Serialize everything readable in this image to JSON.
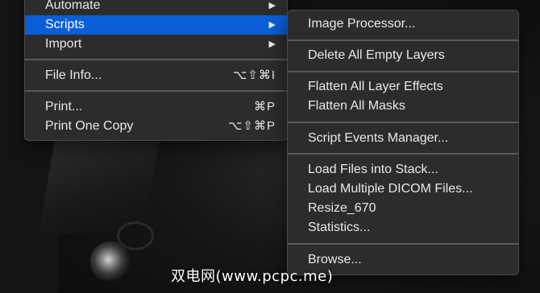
{
  "file_menu": {
    "items": [
      {
        "label": "Automate",
        "arrow": "▶"
      },
      {
        "label": "Scripts",
        "arrow": "▶"
      },
      {
        "label": "Import",
        "arrow": "▶"
      },
      {
        "label": "File Info...",
        "shortcut": "⌥⇧⌘I"
      },
      {
        "label": "Print...",
        "shortcut": "⌘P"
      },
      {
        "label": "Print One Copy",
        "shortcut": "⌥⇧⌘P"
      }
    ]
  },
  "scripts_menu": {
    "items": [
      {
        "label": "Image Processor..."
      },
      {
        "label": "Delete All Empty Layers"
      },
      {
        "label": "Flatten All Layer Effects"
      },
      {
        "label": "Flatten All Masks"
      },
      {
        "label": "Script Events Manager..."
      },
      {
        "label": "Load Files into Stack..."
      },
      {
        "label": "Load Multiple DICOM Files..."
      },
      {
        "label": "Resize_670"
      },
      {
        "label": "Statistics..."
      },
      {
        "label": "Browse..."
      }
    ]
  },
  "watermark": "双电网(www.pcpc.me)",
  "colors": {
    "highlight": "#0a5ed7",
    "menu_bg": "#2c2c2e",
    "menu_text": "#e8e8e8"
  }
}
